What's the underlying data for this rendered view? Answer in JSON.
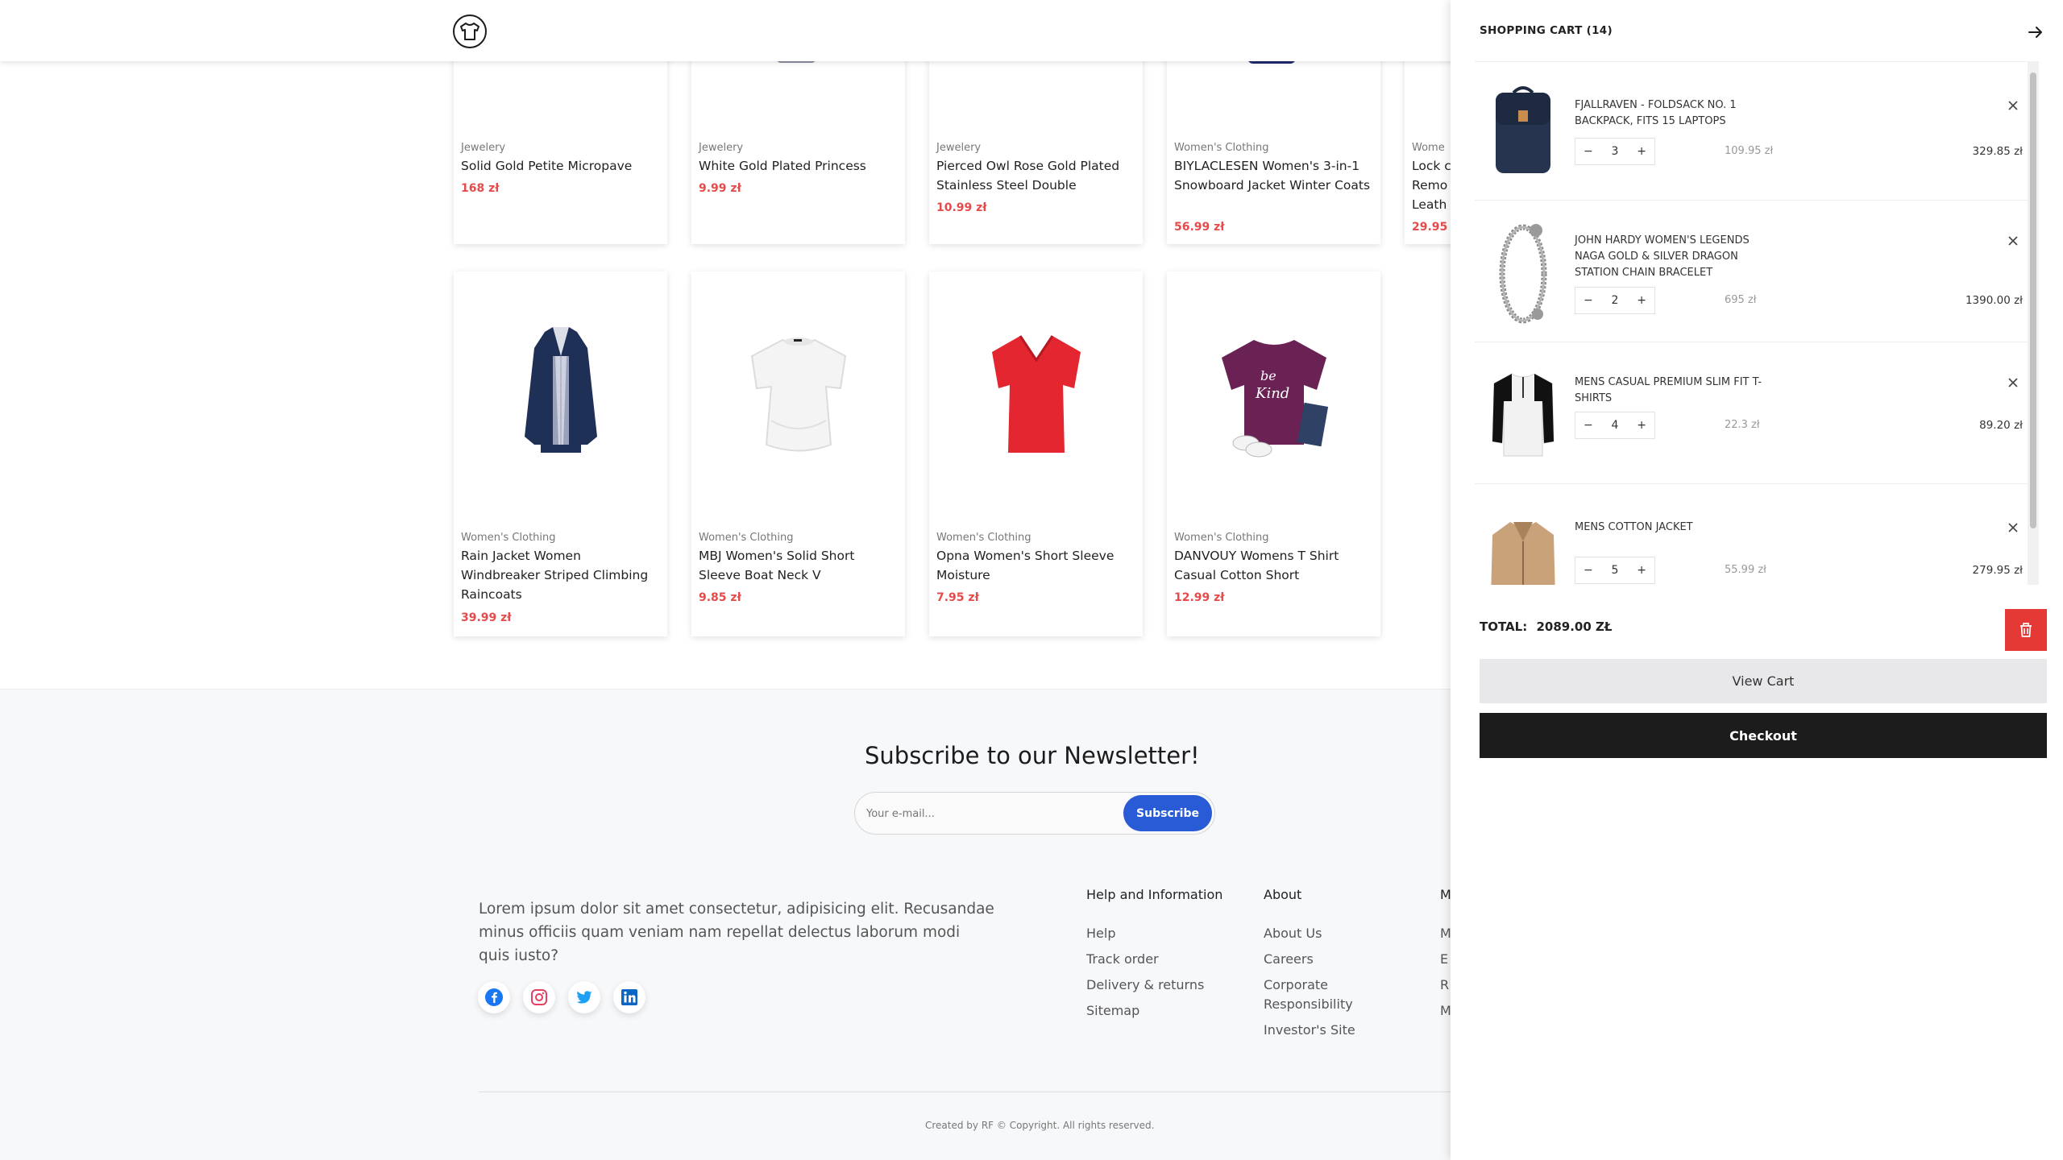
{
  "header": {
    "logo_icon": "tshirt-icon"
  },
  "products": [
    {
      "category": "Jewelery",
      "title": "Solid Gold Petite Micropave",
      "price": "168 zł"
    },
    {
      "category": "Jewelery",
      "title": "White Gold Plated Princess",
      "price": "9.99 zł"
    },
    {
      "category": "Jewelery",
      "title": "Pierced Owl Rose Gold Plated Stainless Steel Double",
      "price": "10.99 zł"
    },
    {
      "category": "Women's Clothing",
      "title": "BIYLACLESEN Women's 3-in-1 Snowboard Jacket Winter Coats",
      "price": "56.99 zł"
    },
    {
      "category": "Wome",
      "title": "Lock c Remo Leath",
      "price": "29.95"
    },
    {
      "category": "Women's Clothing",
      "title": "Rain Jacket Women Windbreaker Striped Climbing Raincoats",
      "price": "39.99 zł"
    },
    {
      "category": "Women's Clothing",
      "title": "MBJ Women's Solid Short Sleeve Boat Neck V",
      "price": "9.85 zł"
    },
    {
      "category": "Women's Clothing",
      "title": "Opna Women's Short Sleeve Moisture",
      "price": "7.95 zł"
    },
    {
      "category": "Women's Clothing",
      "title": "DANVOUY Womens T Shirt Casual Cotton Short",
      "price": "12.99 zł"
    }
  ],
  "newsletter": {
    "title": "Subscribe to our Newsletter!",
    "placeholder": "Your e-mail...",
    "button": "Subscribe"
  },
  "footer": {
    "about": "Lorem ipsum dolor sit amet consectetur, adipisicing elit. Recusandae minus officiis quam veniam nam repellat delectus laborum modi quis iusto?",
    "social": [
      "facebook-icon",
      "instagram-icon",
      "twitter-icon",
      "linkedin-icon"
    ],
    "col1_title": "Help and Information",
    "col1_links": [
      "Help",
      "Track order",
      "Delivery & returns",
      "Sitemap"
    ],
    "col2_title": "About",
    "col2_links": [
      "About Us",
      "Careers",
      "Corporate Responsibility",
      "Investor's Site"
    ],
    "col3_title": "M",
    "col3_links": [
      "M",
      "E",
      "R",
      "M"
    ],
    "copyright": "Created by RF © Copyright. All rights reserved."
  },
  "cart": {
    "title": "SHOPPING CART (14)",
    "items": [
      {
        "name": "FJALLRAVEN - FOLDSACK NO. 1 BACKPACK, FITS 15 LAPTOPS",
        "qty": "3",
        "unit": "109.95 zł",
        "subtotal": "329.85 zł"
      },
      {
        "name": "JOHN HARDY WOMEN'S LEGENDS NAGA GOLD & SILVER DRAGON STATION CHAIN BRACELET",
        "qty": "2",
        "unit": "695 zł",
        "subtotal": "1390.00 zł"
      },
      {
        "name": "MENS CASUAL PREMIUM SLIM FIT T-SHIRTS",
        "qty": "4",
        "unit": "22.3 zł",
        "subtotal": "89.20 zł"
      },
      {
        "name": "MENS COTTON JACKET",
        "qty": "5",
        "unit": "55.99 zł",
        "subtotal": "279.95 zł"
      }
    ],
    "minus": "−",
    "plus": "+",
    "total_label": "TOTAL:",
    "total_value": "2089.00 ZŁ",
    "view_cart": "View Cart",
    "checkout": "Checkout",
    "accent": "#e53935"
  }
}
